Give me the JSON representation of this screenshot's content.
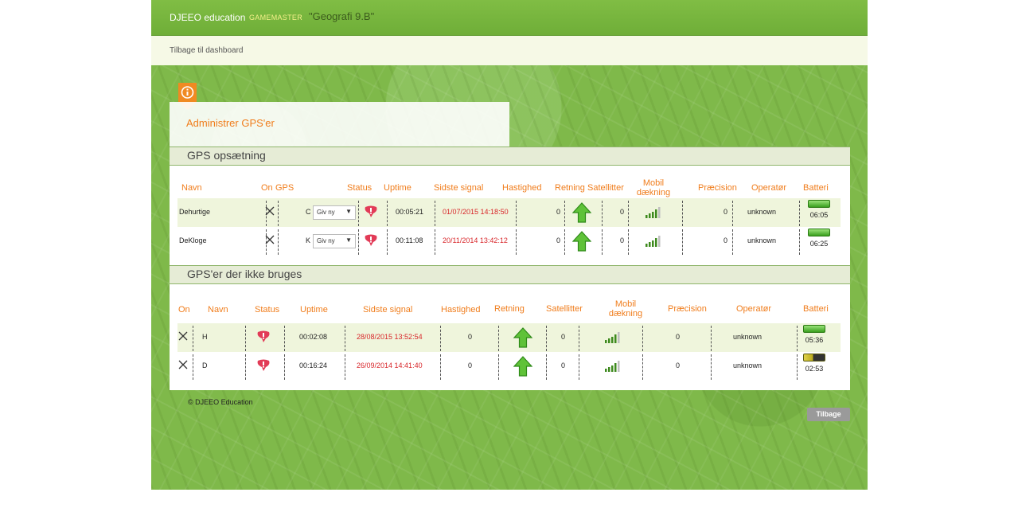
{
  "header": {
    "brand": "DJEEO education",
    "role": "GAMEMASTER",
    "class_name": "\"Geografi 9.B\""
  },
  "subnav": {
    "back_link": "Tilbage til dashboard"
  },
  "card": {
    "title": "Administrer GPS'er"
  },
  "gps_setup": {
    "title": "GPS opsætning",
    "columns": {
      "navn": "Navn",
      "on": "On",
      "gps": "GPS",
      "status": "Status",
      "uptime": "Uptime",
      "sidste_signal": "Sidste signal",
      "hastighed": "Hastighed",
      "retning": "Retning",
      "satellitter": "Satellitter",
      "mobil_line1": "Mobil",
      "mobil_line2": "dækning",
      "praecision": "Præcision",
      "operator": "Operatør",
      "batteri": "Batteri"
    },
    "rows": [
      {
        "navn": "Dehurtige",
        "gps_letter": "C",
        "dropdown": "Giv ny",
        "uptime": "00:05:21",
        "signal": "01/07/2015 14:18:50",
        "hastighed": "0",
        "satellitter": "0",
        "praecision": "0",
        "operator": "unknown",
        "battery_time": "06:05",
        "battery_color": "#3aa01e"
      },
      {
        "navn": "DeKloge",
        "gps_letter": "K",
        "dropdown": "Giv ny",
        "uptime": "00:11:08",
        "signal": "20/11/2014 13:42:12",
        "hastighed": "0",
        "satellitter": "0",
        "praecision": "0",
        "operator": "unknown",
        "battery_time": "06:25",
        "battery_color": "#3aa01e"
      }
    ]
  },
  "gps_unused": {
    "title": "GPS'er der ikke bruges",
    "columns": {
      "on": "On",
      "navn": "Navn",
      "status": "Status",
      "uptime": "Uptime",
      "sidste_signal": "Sidste signal",
      "hastighed": "Hastighed",
      "retning": "Retning",
      "satellitter": "Satellitter",
      "mobil_line1": "Mobil",
      "mobil_line2": "dækning",
      "praecision": "Præcision",
      "operator": "Operatør",
      "batteri": "Batteri"
    },
    "rows": [
      {
        "navn": "H",
        "uptime": "00:02:08",
        "signal": "28/08/2015 13:52:54",
        "hastighed": "0",
        "satellitter": "0",
        "praecision": "0",
        "operator": "unknown",
        "battery_time": "05:36",
        "battery_color": "#3aa01e"
      },
      {
        "navn": "D",
        "uptime": "00:16:24",
        "signal": "26/09/2014 14:41:40",
        "hastighed": "0",
        "satellitter": "0",
        "praecision": "0",
        "operator": "unknown",
        "battery_time": "02:53",
        "battery_color": "#b8a81a"
      }
    ]
  },
  "footer": {
    "copyright": "© DJEEO Education",
    "back_button": "Tilbage"
  },
  "colors": {
    "accent": "#f07d1c",
    "header_green": "#7ab83f",
    "signal_red": "#d8262a"
  },
  "icons": [
    "info-icon",
    "remove-x-icon",
    "status-alert-icon",
    "direction-arrow-icon",
    "signal-bars-icon",
    "battery-icon"
  ]
}
